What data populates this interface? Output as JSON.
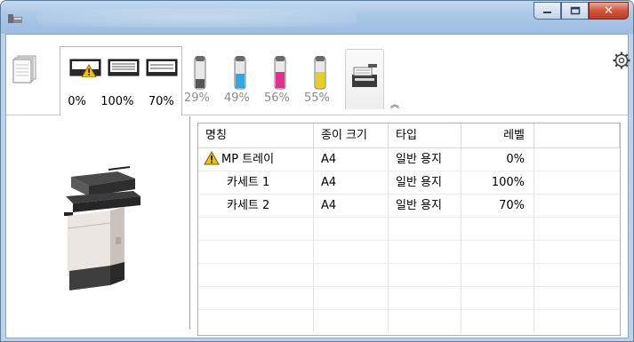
{
  "window": {
    "title": ""
  },
  "trays": {
    "levels": [
      "0%",
      "100%",
      "70%"
    ]
  },
  "toners": [
    {
      "level": "29%",
      "color": "#555555"
    },
    {
      "level": "49%",
      "color": "#30a8e0"
    },
    {
      "level": "56%",
      "color": "#e0308c"
    },
    {
      "level": "55%",
      "color": "#e8d020"
    }
  ],
  "table": {
    "headers": [
      "명칭",
      "종이 크기",
      "타입",
      "레벨"
    ],
    "rows": [
      {
        "name": "MP 트레이",
        "size": "A4",
        "type": "일반 용지",
        "level": "0%",
        "warning": true
      },
      {
        "name": "카세트 1",
        "size": "A4",
        "type": "일반 용지",
        "level": "100%",
        "warning": false
      },
      {
        "name": "카세트 2",
        "size": "A4",
        "type": "일반 용지",
        "level": "70%",
        "warning": false
      }
    ]
  },
  "icons": {
    "expand": "chevron-up-double-icon",
    "settings": "gear-icon",
    "warning": "warning-icon"
  }
}
